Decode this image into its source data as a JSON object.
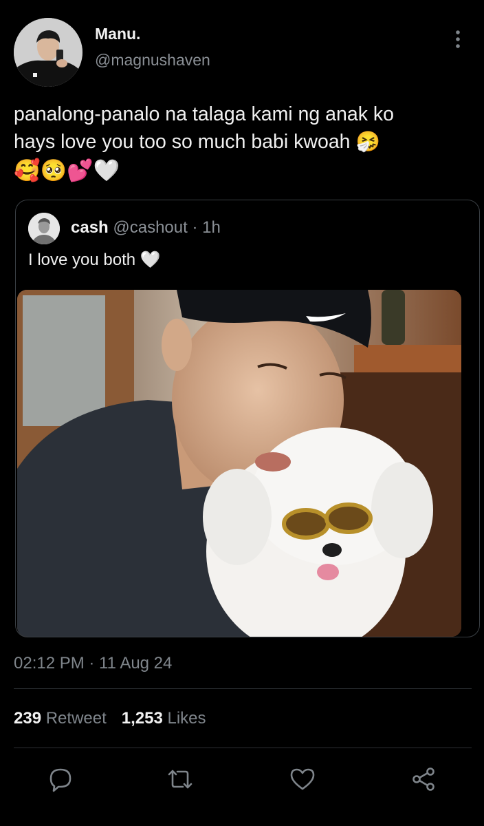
{
  "author": {
    "name": "Manu.",
    "handle": "@magnushaven"
  },
  "tweet": {
    "text": "panalong-panalo na talaga kami ng anak ko\nhays love you too so much babi kwoah 🤧",
    "emojis": "🥰🥺💕🤍"
  },
  "quoted_tweet": {
    "name": "cash",
    "handle": "@cashout",
    "time": "· 1h",
    "text": "I love you both 🤍"
  },
  "timestamp": "02:12 PM · 11 Aug 24",
  "stats": {
    "retweets_count": "239",
    "retweets_label": "Retweet",
    "likes_count": "1,253",
    "likes_label": "Likes"
  },
  "icons": {
    "more": "more-vertical-icon",
    "reply": "reply-icon",
    "retweet": "retweet-icon",
    "like": "heart-icon",
    "share": "share-icon"
  },
  "colors": {
    "background": "#000000",
    "text_primary": "#e7e9ea",
    "text_secondary": "#8b9096",
    "border": "#3a3f44"
  }
}
